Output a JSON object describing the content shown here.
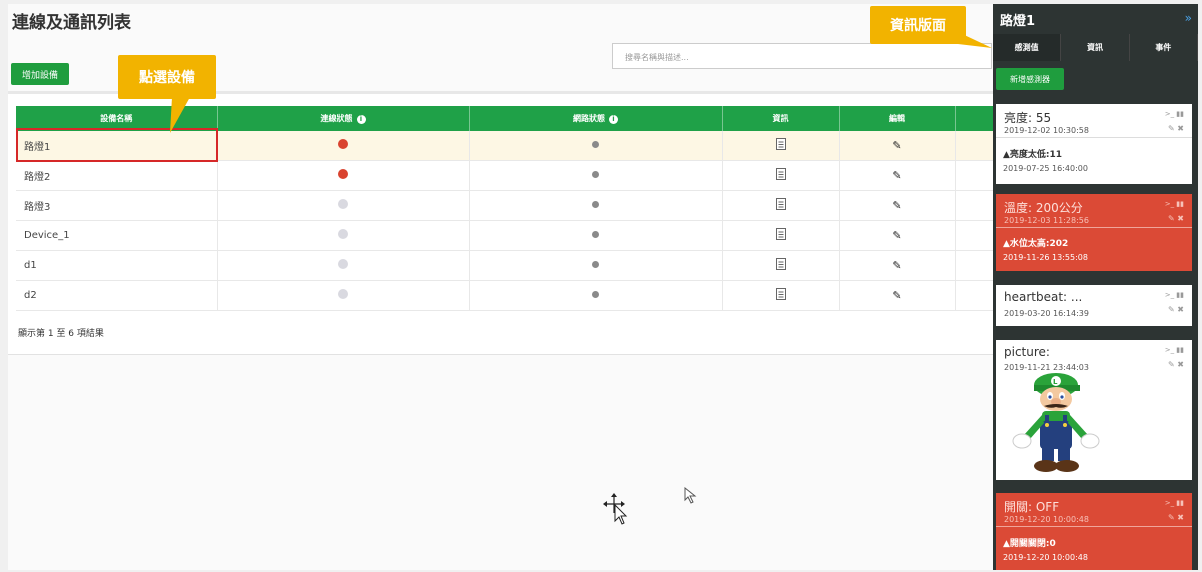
{
  "main": {
    "title": "連線及通訊列表",
    "add_device_label": "增加設備",
    "search_placeholder": "搜尋名稱與描述...",
    "table": {
      "headers": {
        "device_name": "設備名稱",
        "connection_status": "連線狀態",
        "network_status": "網路狀態",
        "info": "資訊",
        "edit": "編輯"
      },
      "rows": [
        {
          "name": "路燈1",
          "connection": "red",
          "selected": true
        },
        {
          "name": "路燈2",
          "connection": "red",
          "selected": false
        },
        {
          "name": "路燈3",
          "connection": "grey",
          "selected": false
        },
        {
          "name": "Device_1",
          "connection": "grey",
          "selected": false
        },
        {
          "name": "d1",
          "connection": "grey",
          "selected": false
        },
        {
          "name": "d2",
          "connection": "grey",
          "selected": false
        }
      ]
    },
    "pager_text": "顯示第 1 至 6 項結果"
  },
  "annotations": {
    "select_device_label": "點選設備",
    "info_panel_label": "資訊版面"
  },
  "panel": {
    "title": "路燈1",
    "toggle_icon": "»",
    "tabs": [
      "感測值",
      "資訊",
      "事件"
    ],
    "add_sensor_label": "新增感測器",
    "sensors": [
      {
        "title": "亮度: 55",
        "time": "2019-12-02 10:30:58",
        "alert": "▲亮度太低:11",
        "alert_time": "2019-07-25 16:40:00",
        "status": "normal"
      },
      {
        "title": "溫度: 200公分",
        "time": "2019-12-03 11:28:56",
        "alert": "▲水位太高:202",
        "alert_time": "2019-11-26 13:55:08",
        "status": "alarm"
      },
      {
        "title": "heartbeat: ...",
        "time": "2019-03-20 16:14:39",
        "status": "normal"
      },
      {
        "title": "picture:",
        "time": "2019-11-21 23:44:03",
        "status": "normal",
        "image": "luigi-character"
      },
      {
        "title": "開關: OFF",
        "time": "2019-12-20 10:00:48",
        "alert": "▲開關關閉:0",
        "alert_time": "2019-12-20 10:00:48",
        "status": "alarm"
      }
    ]
  },
  "colors": {
    "accent_green": "#1fa148",
    "panel_bg": "#2d3433",
    "alarm_red": "#db4a36",
    "callout_yellow": "#f2b300",
    "selection_red": "#d62828"
  }
}
